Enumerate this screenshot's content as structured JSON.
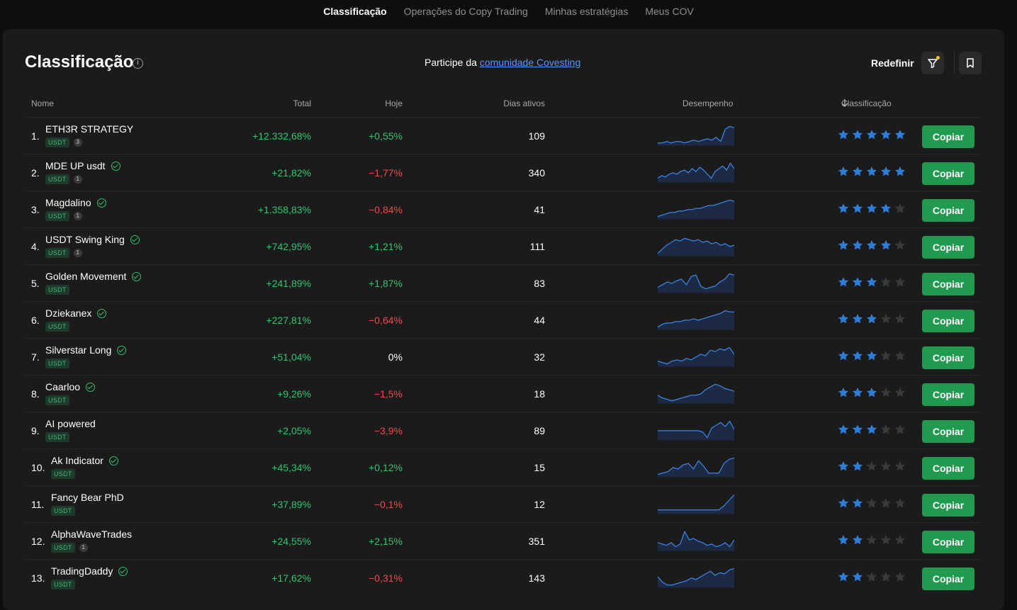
{
  "topnav": {
    "tabs": [
      {
        "label": "Classificação",
        "active": true
      },
      {
        "label": "Operações do Copy Trading",
        "active": false
      },
      {
        "label": "Minhas estratégias",
        "active": false
      },
      {
        "label": "Meus COV",
        "active": false
      }
    ]
  },
  "header": {
    "title": "Classificação",
    "info_icon": "info-icon",
    "community_prefix": "Participe da",
    "community_link": "comunidade Covesting",
    "reset_label": "Redefinir",
    "filter_icon": "filter-icon",
    "bookmark_icon": "bookmark-icon"
  },
  "table": {
    "columns": {
      "name": "Nome",
      "total": "Total",
      "today": "Hoje",
      "days": "Dias ativos",
      "performance": "Desempenho",
      "rank": "Classificação",
      "sort_icon": "arrow-down-icon"
    },
    "colors": {
      "positive": "#35c36f",
      "negative": "#f04a4a",
      "star": "#2e7dd7",
      "star_empty": "#3a3a3a",
      "copy_button": "#1f9a4e"
    },
    "rows": [
      {
        "rank": "1.",
        "name": "ETH3R STRATEGY",
        "verified": false,
        "tag": "USDT",
        "count": "3",
        "total": "+12.332,68%",
        "today": "+0,55%",
        "today_sign": "pos",
        "days": "109",
        "stars": 5,
        "copy": "Copiar",
        "spark": [
          2,
          2,
          3,
          2,
          3,
          3,
          2,
          3,
          4,
          3,
          4,
          5,
          4,
          6,
          3,
          12,
          14,
          13
        ]
      },
      {
        "rank": "2.",
        "name": "MDE UP usdt",
        "verified": true,
        "tag": "USDT",
        "count": "1",
        "total": "+21,82%",
        "today": "−1,77%",
        "today_sign": "neg",
        "days": "340",
        "stars": 5,
        "copy": "Copiar",
        "spark": [
          3,
          5,
          4,
          6,
          7,
          6,
          8,
          9,
          7,
          10,
          8,
          11,
          9,
          6,
          3,
          8,
          10,
          12,
          9,
          14,
          10
        ]
      },
      {
        "rank": "3.",
        "name": "Magdalino",
        "verified": true,
        "tag": "USDT",
        "count": "1",
        "total": "+1.358,83%",
        "today": "−0,84%",
        "today_sign": "neg",
        "days": "41",
        "stars": 4,
        "copy": "Copiar",
        "spark": [
          2,
          3,
          4,
          5,
          5,
          6,
          6,
          7,
          7,
          8,
          8,
          9,
          10,
          10,
          11,
          12,
          13,
          14,
          13
        ]
      },
      {
        "rank": "4.",
        "name": "USDT Swing King",
        "verified": true,
        "tag": "USDT",
        "count": "1",
        "total": "+742,95%",
        "today": "+1,21%",
        "today_sign": "pos",
        "days": "111",
        "stars": 4,
        "copy": "Copiar",
        "spark": [
          2,
          5,
          8,
          10,
          12,
          11,
          13,
          12,
          11,
          12,
          10,
          11,
          9,
          10,
          8,
          9,
          7,
          8
        ]
      },
      {
        "rank": "5.",
        "name": "Golden Movement",
        "verified": true,
        "tag": "USDT",
        "count": "",
        "total": "+241,89%",
        "today": "+1,87%",
        "today_sign": "pos",
        "days": "83",
        "stars": 3,
        "copy": "Copiar",
        "spark": [
          4,
          6,
          8,
          7,
          9,
          10,
          6,
          12,
          13,
          5,
          3,
          4,
          5,
          8,
          10,
          14,
          13
        ]
      },
      {
        "rank": "6.",
        "name": "Dziekanex",
        "verified": true,
        "tag": "USDT",
        "count": "",
        "total": "+227,81%",
        "today": "−0,64%",
        "today_sign": "neg",
        "days": "44",
        "stars": 3,
        "copy": "Copiar",
        "spark": [
          2,
          4,
          5,
          5,
          6,
          6,
          7,
          7,
          8,
          7,
          8,
          9,
          10,
          11,
          12,
          14,
          13,
          13
        ]
      },
      {
        "rank": "7.",
        "name": "Silverstar Long",
        "verified": true,
        "tag": "USDT",
        "count": "",
        "total": "+51,04%",
        "today": "0%",
        "today_sign": "neu",
        "days": "32",
        "stars": 3,
        "copy": "Copiar",
        "spark": [
          4,
          3,
          2,
          4,
          5,
          4,
          6,
          5,
          7,
          9,
          8,
          12,
          11,
          13,
          12,
          14,
          9
        ]
      },
      {
        "rank": "8.",
        "name": "Caarloo",
        "verified": true,
        "tag": "USDT",
        "count": "",
        "total": "+9,26%",
        "today": "−1,5%",
        "today_sign": "neg",
        "days": "18",
        "stars": 3,
        "copy": "Copiar",
        "spark": [
          6,
          4,
          3,
          2,
          3,
          4,
          5,
          6,
          6,
          7,
          10,
          12,
          14,
          13,
          11,
          10,
          9
        ]
      },
      {
        "rank": "9.",
        "name": "AI powered",
        "verified": false,
        "tag": "USDT",
        "count": "",
        "total": "+2,05%",
        "today": "−3,9%",
        "today_sign": "neg",
        "days": "89",
        "stars": 3,
        "copy": "Copiar",
        "spark": [
          7,
          7,
          7,
          7,
          7,
          7,
          7,
          7,
          7,
          7,
          6,
          2,
          9,
          11,
          13,
          10,
          14,
          8
        ]
      },
      {
        "rank": "10.",
        "name": "Ak Indicator",
        "verified": true,
        "tag": "USDT",
        "count": "",
        "total": "+45,34%",
        "today": "+0,12%",
        "today_sign": "pos",
        "days": "15",
        "stars": 2,
        "copy": "Copiar",
        "spark": [
          2,
          3,
          4,
          7,
          6,
          9,
          10,
          6,
          12,
          8,
          3,
          3,
          3,
          10,
          13,
          14
        ]
      },
      {
        "rank": "11.",
        "name": "Fancy Bear PhD",
        "verified": false,
        "tag": "USDT",
        "count": "",
        "total": "+37,89%",
        "today": "−0,1%",
        "today_sign": "neg",
        "days": "12",
        "stars": 2,
        "copy": "Copiar",
        "spark": [
          3,
          3,
          3,
          3,
          3,
          3,
          3,
          3,
          3,
          3,
          3,
          3,
          3,
          6,
          10,
          14
        ]
      },
      {
        "rank": "12.",
        "name": "AlphaWaveTrades",
        "verified": false,
        "tag": "USDT",
        "count": "1",
        "total": "+24,55%",
        "today": "+2,15%",
        "today_sign": "pos",
        "days": "351",
        "stars": 2,
        "copy": "Copiar",
        "spark": [
          6,
          5,
          4,
          6,
          3,
          5,
          14,
          8,
          9,
          7,
          6,
          4,
          5,
          3,
          4,
          6,
          3,
          8
        ]
      },
      {
        "rank": "13.",
        "name": "TradingDaddy",
        "verified": true,
        "tag": "USDT",
        "count": "",
        "total": "+17,62%",
        "today": "−0,31%",
        "today_sign": "neg",
        "days": "143",
        "stars": 2,
        "copy": "Copiar",
        "spark": [
          8,
          4,
          2,
          2,
          3,
          4,
          5,
          7,
          6,
          8,
          10,
          12,
          9,
          11,
          10,
          13,
          14
        ]
      }
    ]
  }
}
